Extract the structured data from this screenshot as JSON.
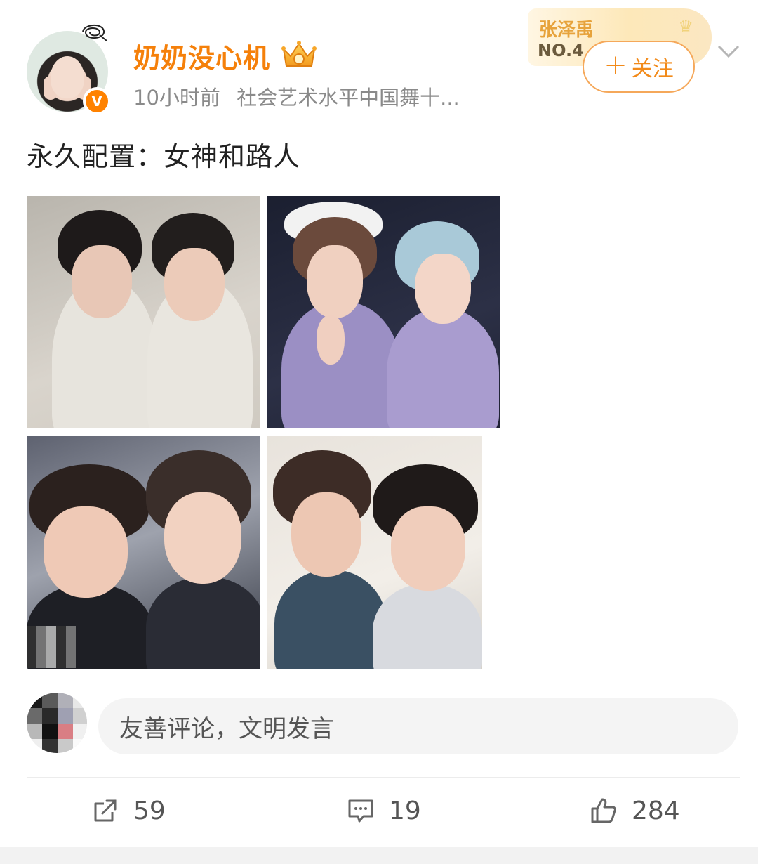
{
  "post": {
    "author": {
      "name": "奶奶没心机",
      "verified_badge": "V",
      "crown_icon": "crown-icon"
    },
    "time": "10小时前",
    "source": "社会艺术水平中国舞十...",
    "text": "永久配置：女神和路人",
    "fan_badge": {
      "name": "张泽禹",
      "rank": "NO.4"
    },
    "follow_label": "关注",
    "follow_plus": "+",
    "images_count_shown": 4
  },
  "comment": {
    "placeholder": "友善评论，文明发言"
  },
  "actions": {
    "share_count": "59",
    "comment_count": "19",
    "like_count": "284"
  },
  "colors": {
    "username": "#f5800a",
    "follow_border": "#f5a85a",
    "verified": "#ff8200"
  }
}
